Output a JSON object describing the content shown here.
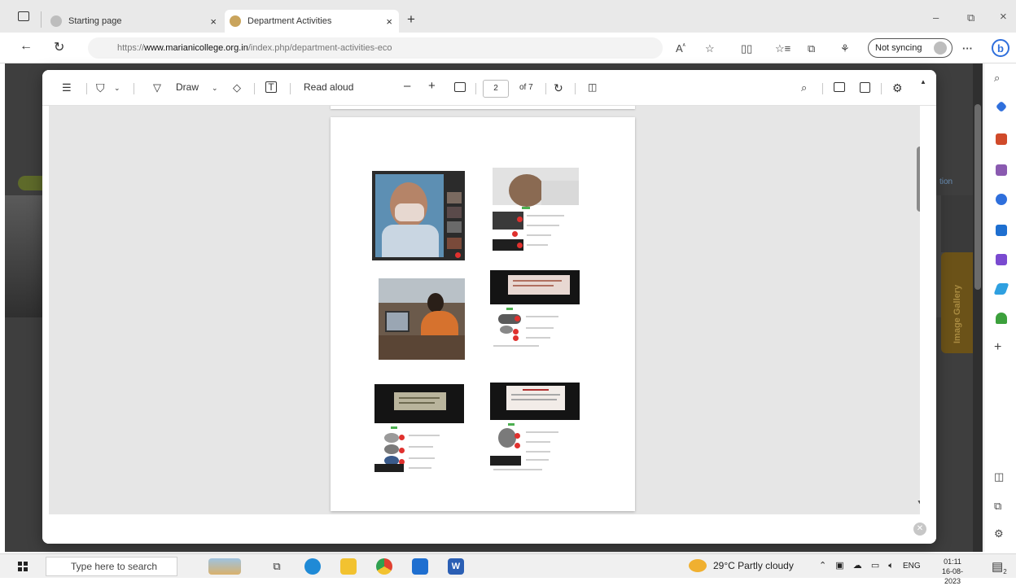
{
  "browser": {
    "tabs": [
      {
        "label": "Starting page",
        "active": false
      },
      {
        "label": "Department Activities",
        "active": true
      }
    ],
    "new_tab_label": "+",
    "tab_close_label": "×",
    "window_buttons": {
      "minimize": "–",
      "restore": "⧉",
      "close": "×"
    },
    "url": {
      "scheme": "https://",
      "domain": "www.marianicollege.org.in",
      "path": "/index.php/department-activities-eco"
    },
    "profile_label": "Not syncing",
    "more_label": "···",
    "bing_label": "b"
  },
  "background_page": {
    "gallery_label": "Image Gallery",
    "right_text": "tion"
  },
  "pdf": {
    "draw_label": "Draw",
    "read_aloud_label": "Read aloud",
    "zoom_out": "–",
    "zoom_in": "+",
    "page_current": "2",
    "page_total": "of 7"
  },
  "taskbar": {
    "search_placeholder": "Type here to search",
    "weather": "29°C  Partly cloudy",
    "language": "ENG",
    "time": "01:11",
    "date": "16-08-2023",
    "notification_count": "2"
  },
  "colors": {
    "accent": "#2f6fdc",
    "page_dim": "#3e3e3e",
    "pdf_canvas": "#e6e6e6"
  }
}
